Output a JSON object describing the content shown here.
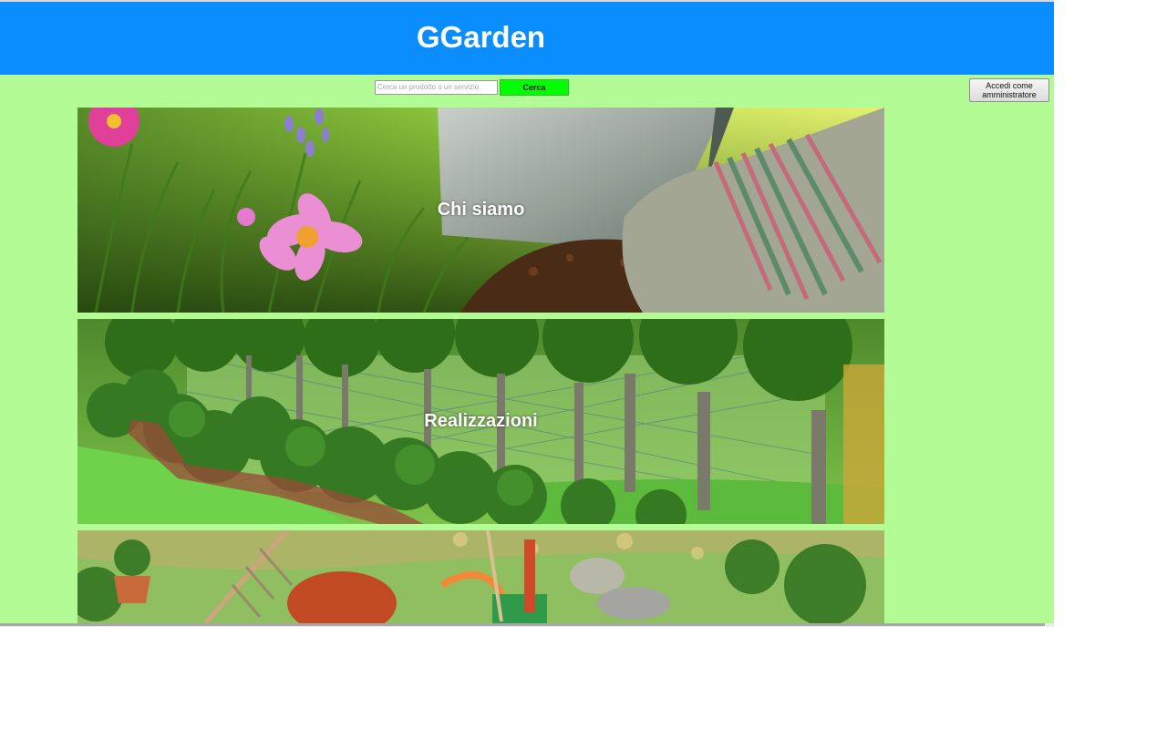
{
  "header": {
    "title": "GGarden"
  },
  "search": {
    "placeholder": "Cerca un prodotto o un servizio",
    "button_label": "Cerca"
  },
  "admin": {
    "button_label": "Accedi come amministratore"
  },
  "banners": [
    {
      "label": "Chi siamo"
    },
    {
      "label": "Realizzazioni"
    },
    {
      "label": ""
    }
  ],
  "colors": {
    "header_bg": "#0a8eff",
    "page_bg": "#b3fb95",
    "search_button_bg": "#00ff00"
  }
}
